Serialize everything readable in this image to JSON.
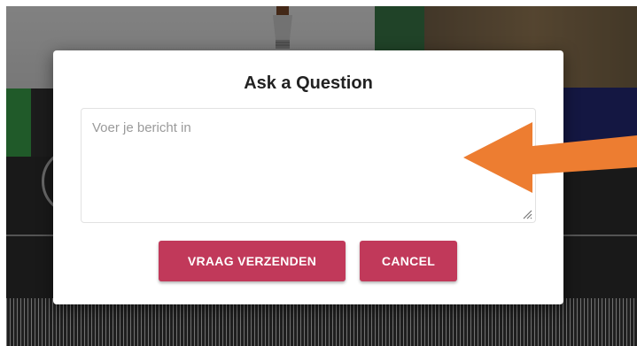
{
  "dialog": {
    "title": "Ask a Question",
    "message_placeholder": "Voer je bericht in",
    "message_value": "",
    "send_label": "VRAAG VERZENDEN",
    "cancel_label": "CANCEL"
  },
  "colors": {
    "button": "#c1395a",
    "arrow": "#ed7d31",
    "overlay": "rgba(0,0,0,0.45)"
  },
  "annotation": {
    "icon": "arrow-left-icon"
  }
}
